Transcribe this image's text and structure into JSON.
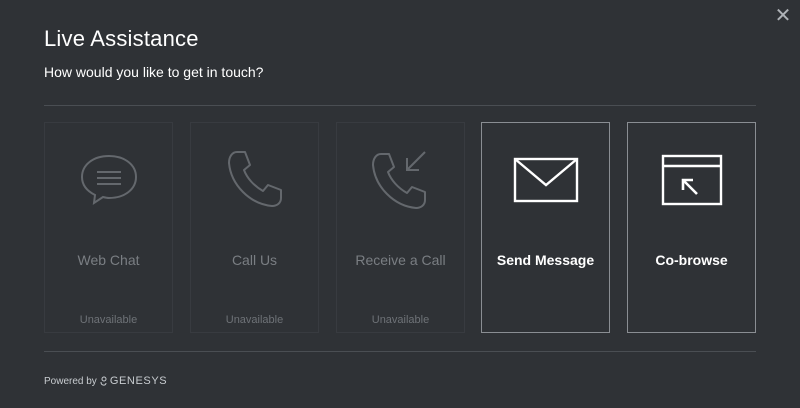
{
  "dialog": {
    "title": "Live Assistance",
    "subtitle": "How would you like to get in touch?",
    "close_icon": "close-icon"
  },
  "channels": [
    {
      "label": "Web Chat",
      "status": "Unavailable",
      "icon": "chat-bubble-icon",
      "available": false
    },
    {
      "label": "Call Us",
      "status": "Unavailable",
      "icon": "phone-icon",
      "available": false
    },
    {
      "label": "Receive a Call",
      "status": "Unavailable",
      "icon": "phone-incoming-icon",
      "available": false
    },
    {
      "label": "Send Message",
      "status": "",
      "icon": "envelope-icon",
      "available": true
    },
    {
      "label": "Co-browse",
      "status": "",
      "icon": "cobrowse-icon",
      "available": true
    }
  ],
  "footer": {
    "powered_by": "Powered by",
    "brand": "GENESYS"
  },
  "colors": {
    "background": "#2f3236",
    "disabled": "#6e7277",
    "enabled": "#ffffff"
  }
}
